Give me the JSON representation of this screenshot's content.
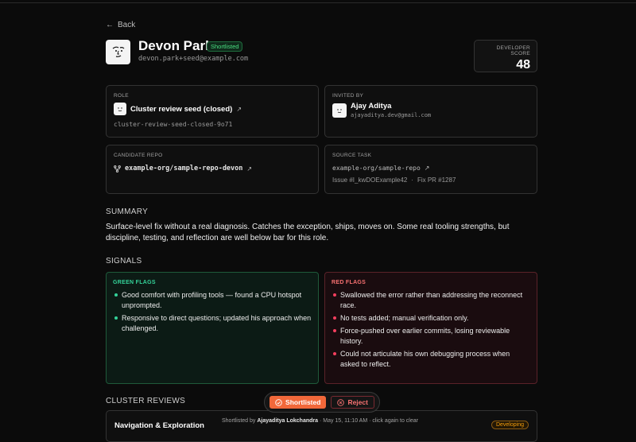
{
  "nav": {
    "back_label": "Back"
  },
  "candidate": {
    "name": "Devon Park",
    "status_badge": "Shortlisted",
    "email": "devon.park+seed@example.com"
  },
  "score": {
    "label": "DEVELOPER SCORE",
    "value": "48"
  },
  "role": {
    "label": "ROLE",
    "title": "Cluster review seed (closed)",
    "slug": "cluster-review-seed-closed-9o71"
  },
  "invited": {
    "label": "INVITED BY",
    "name": "Ajay Aditya",
    "email": "ajayaditya.dev@gmail.com"
  },
  "repo": {
    "label": "CANDIDATE REPO",
    "name": "example-org/sample-repo-devon"
  },
  "task": {
    "label": "SOURCE TASK",
    "repo": "example-org/sample-repo",
    "issue": "Issue #I_kwDOExample42",
    "separator": "·",
    "pr": "Fix PR #1287"
  },
  "summary": {
    "heading": "SUMMARY",
    "text": "Surface-level fix without a real diagnosis. Catches the exception, ships, moves on. Some real tooling strengths, but discipline, testing, and reflection are well below bar for this role."
  },
  "signals": {
    "heading": "SIGNALS",
    "green_title": "GREEN FLAGS",
    "green": [
      "Good comfort with profiling tools — found a CPU hotspot unprompted.",
      "Responsive to direct questions; updated his approach when challenged."
    ],
    "red_title": "RED FLAGS",
    "red": [
      "Swallowed the error rather than addressing the reconnect race.",
      "No tests added; manual verification only.",
      "Force-pushed over earlier commits, losing reviewable history.",
      "Could not articulate his own debugging process when asked to reflect."
    ]
  },
  "cluster": {
    "heading": "CLUSTER REVIEWS",
    "first_title": "Navigation & Exploration",
    "first_badge": "Developing"
  },
  "decision_bar": {
    "shortlist_label": "Shortlisted",
    "reject_label": "Reject",
    "note_prefix": "Shortlisted by",
    "note_name": "Ajayaditya Lokchandra",
    "note_suffix": "· May 15, 11:10 AM · click again to clear"
  },
  "colors": {
    "accent": "#f1683a",
    "green": "#34d399",
    "red": "#f43f5e",
    "amber": "#f59e0b"
  }
}
